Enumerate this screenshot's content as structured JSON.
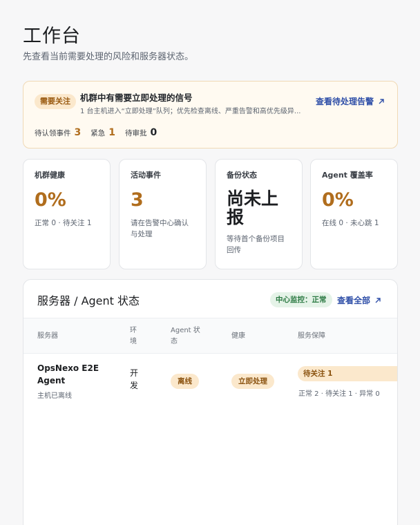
{
  "header": {
    "title": "工作台",
    "subtitle": "先查看当前需要处理的风险和服务器状态。"
  },
  "alert": {
    "badge": "需要关注",
    "title": "机群中有需要立即处理的信号",
    "description": "1 台主机进入“立即处理”队列；优先检查离线、严重告警和高优先级异...",
    "link_label": "查看待处理告警",
    "stats": [
      {
        "label": "待认领事件",
        "value": "3"
      },
      {
        "label": "紧急",
        "value": "1"
      },
      {
        "label": "待审批",
        "value": "0"
      }
    ]
  },
  "cards": [
    {
      "label": "机群健康",
      "value": "0%",
      "note": "正常 0 · 待关注 1"
    },
    {
      "label": "活动事件",
      "value": "3",
      "note": "请在告警中心确认与处理"
    },
    {
      "label": "备份状态",
      "value": "尚未上报",
      "note": "等待首个备份项目回传"
    },
    {
      "label": "Agent 覆盖率",
      "value": "0%",
      "note": "在线 0 · 未心跳 1"
    }
  ],
  "panel": {
    "title": "服务器 / Agent 状态",
    "monitor_status": "中心监控：正常",
    "view_all_label": "查看全部",
    "columns": [
      "服务器",
      "环境",
      "Agent 状态",
      "健康",
      "服务保障"
    ],
    "rows": [
      {
        "name": "OpsNexo E2E Agent",
        "subtitle": "主机已离线",
        "env": "开发",
        "agent_status": "离线",
        "health": "立即处理",
        "guarantee_badge": "待关注 1",
        "guarantee_note": "正常 2 · 待关注 1 · 异常 0"
      }
    ]
  },
  "colors": {
    "accent_warning": "#b06d1d",
    "link": "#2f4fa8",
    "ok": "#2c7a43"
  }
}
